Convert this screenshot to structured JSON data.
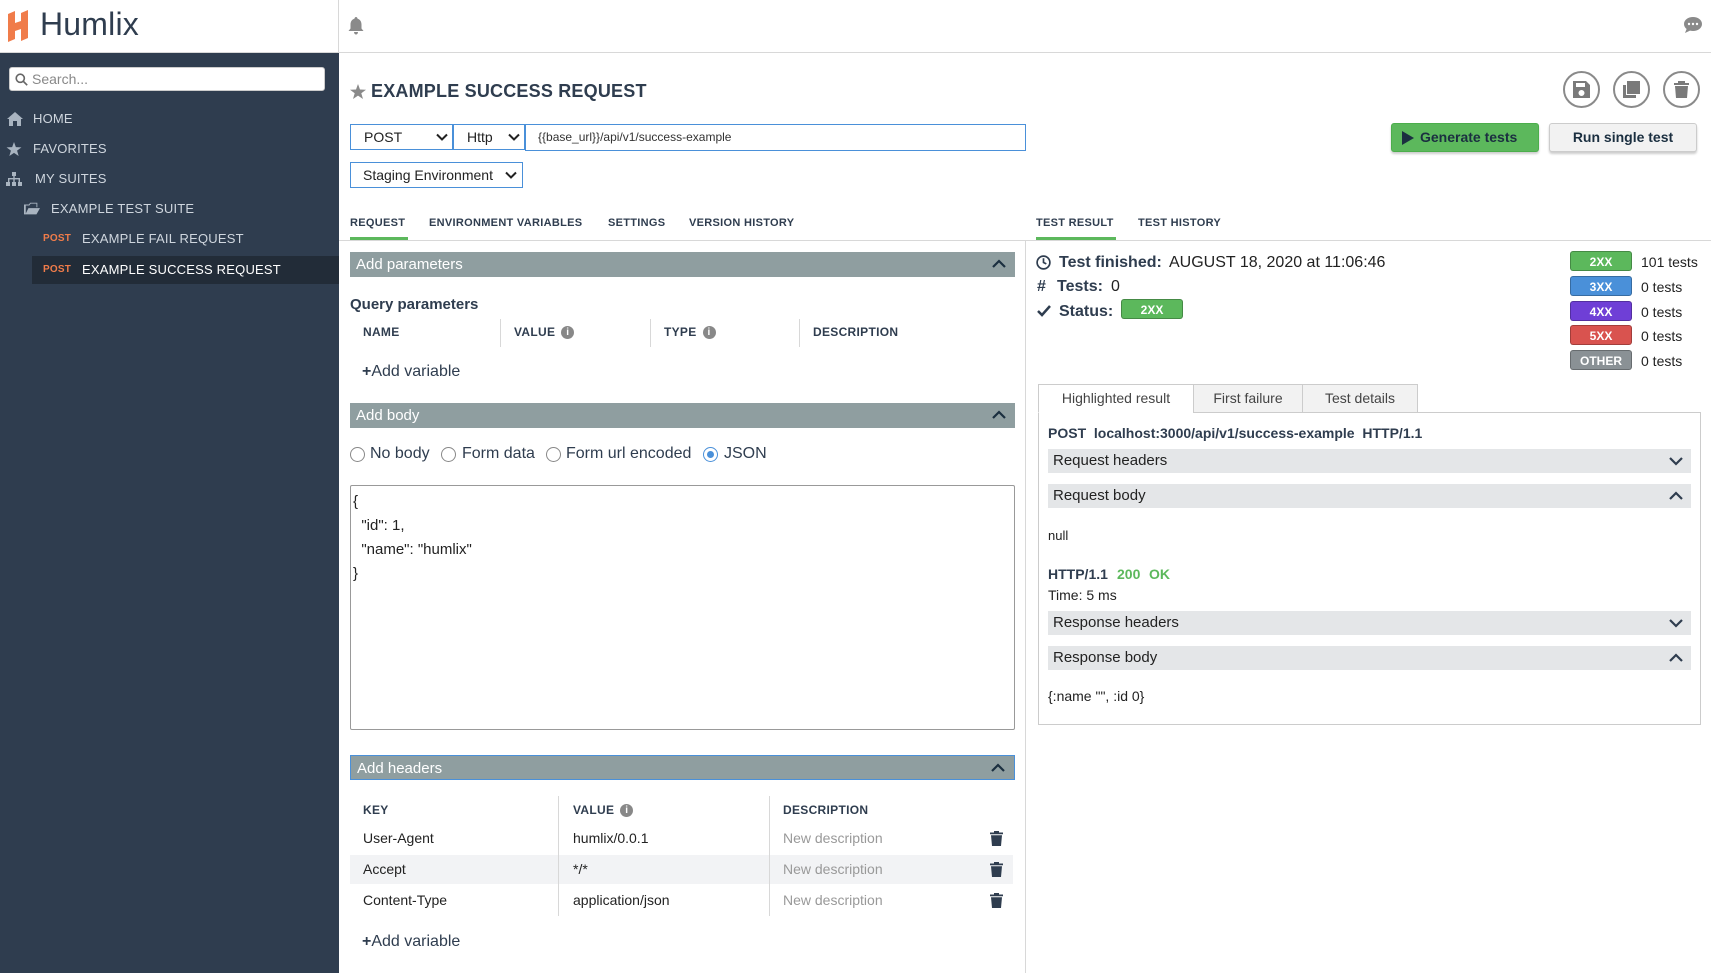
{
  "app": {
    "name": "Humlix"
  },
  "search": {
    "placeholder": "Search..."
  },
  "nav": {
    "home": "HOME",
    "favorites": "FAVORITES",
    "my_suites": "MY SUITES",
    "suite": "EXAMPLE TEST SUITE",
    "requests": [
      {
        "method": "POST",
        "label": "EXAMPLE FAIL REQUEST",
        "active": false
      },
      {
        "method": "POST",
        "label": "EXAMPLE SUCCESS REQUEST",
        "active": true
      }
    ]
  },
  "request": {
    "title": "EXAMPLE SUCCESS REQUEST",
    "method": "POST",
    "protocol": "Http",
    "url": "{{base_url}}/api/v1/success-example",
    "environment": "Staging Environment",
    "generate_label": "Generate tests",
    "run_label": "Run single test"
  },
  "tabs": {
    "left": [
      "REQUEST",
      "ENVIRONMENT VARIABLES",
      "SETTINGS",
      "VERSION HISTORY"
    ],
    "right": [
      "TEST RESULT",
      "TEST HISTORY"
    ]
  },
  "params": {
    "section": "Add parameters",
    "heading": "Query parameters",
    "cols": [
      "NAME",
      "VALUE",
      "TYPE",
      "DESCRIPTION"
    ],
    "add_label": "Add variable"
  },
  "body": {
    "section": "Add body",
    "options": [
      "No body",
      "Form data",
      "Form url encoded",
      "JSON"
    ],
    "selected": "JSON",
    "lines": [
      "{",
      "  \"id\": 1,",
      "  \"name\": \"humlix\"",
      "}"
    ]
  },
  "headers": {
    "section": "Add headers",
    "cols": [
      "KEY",
      "VALUE",
      "DESCRIPTION"
    ],
    "rows": [
      {
        "key": "User-Agent",
        "value": "humlix/0.0.1",
        "description": "New description"
      },
      {
        "key": "Accept",
        "value": "*/*",
        "description": "New description"
      },
      {
        "key": "Content-Type",
        "value": "application/json",
        "description": "New description"
      }
    ],
    "add_label": "Add variable"
  },
  "result": {
    "finished_label": "Test finished:",
    "finished_value": "AUGUST 18, 2020 at 11:06:46",
    "tests_label": "Tests:",
    "tests_value": "0",
    "status_label": "Status:",
    "status_value": "2XX",
    "status_color": "#5cb85c",
    "summary": [
      {
        "badge": "2XX",
        "count": "101 tests",
        "color": "#5cb85c"
      },
      {
        "badge": "3XX",
        "count": "0 tests",
        "color": "#4a90d9"
      },
      {
        "badge": "4XX",
        "count": "0 tests",
        "color": "#6f3fd6"
      },
      {
        "badge": "5XX",
        "count": "0 tests",
        "color": "#d9534f"
      },
      {
        "badge": "OTHER",
        "count": "0 tests",
        "color": "#8a9195"
      }
    ],
    "subtabs": [
      "Highlighted result",
      "First failure",
      "Test details"
    ],
    "request_line": "POST  localhost:3000/api/v1/success-example  HTTP/1.1",
    "request_headers": "Request headers",
    "request_body": "Request body",
    "request_body_value": "null",
    "http_version": "HTTP/1.1",
    "status_code": "200",
    "status_text": "OK",
    "time": "Time: 5 ms",
    "response_headers": "Response headers",
    "response_body": "Response body",
    "response_body_value": "{:name \"\", :id 0}"
  }
}
